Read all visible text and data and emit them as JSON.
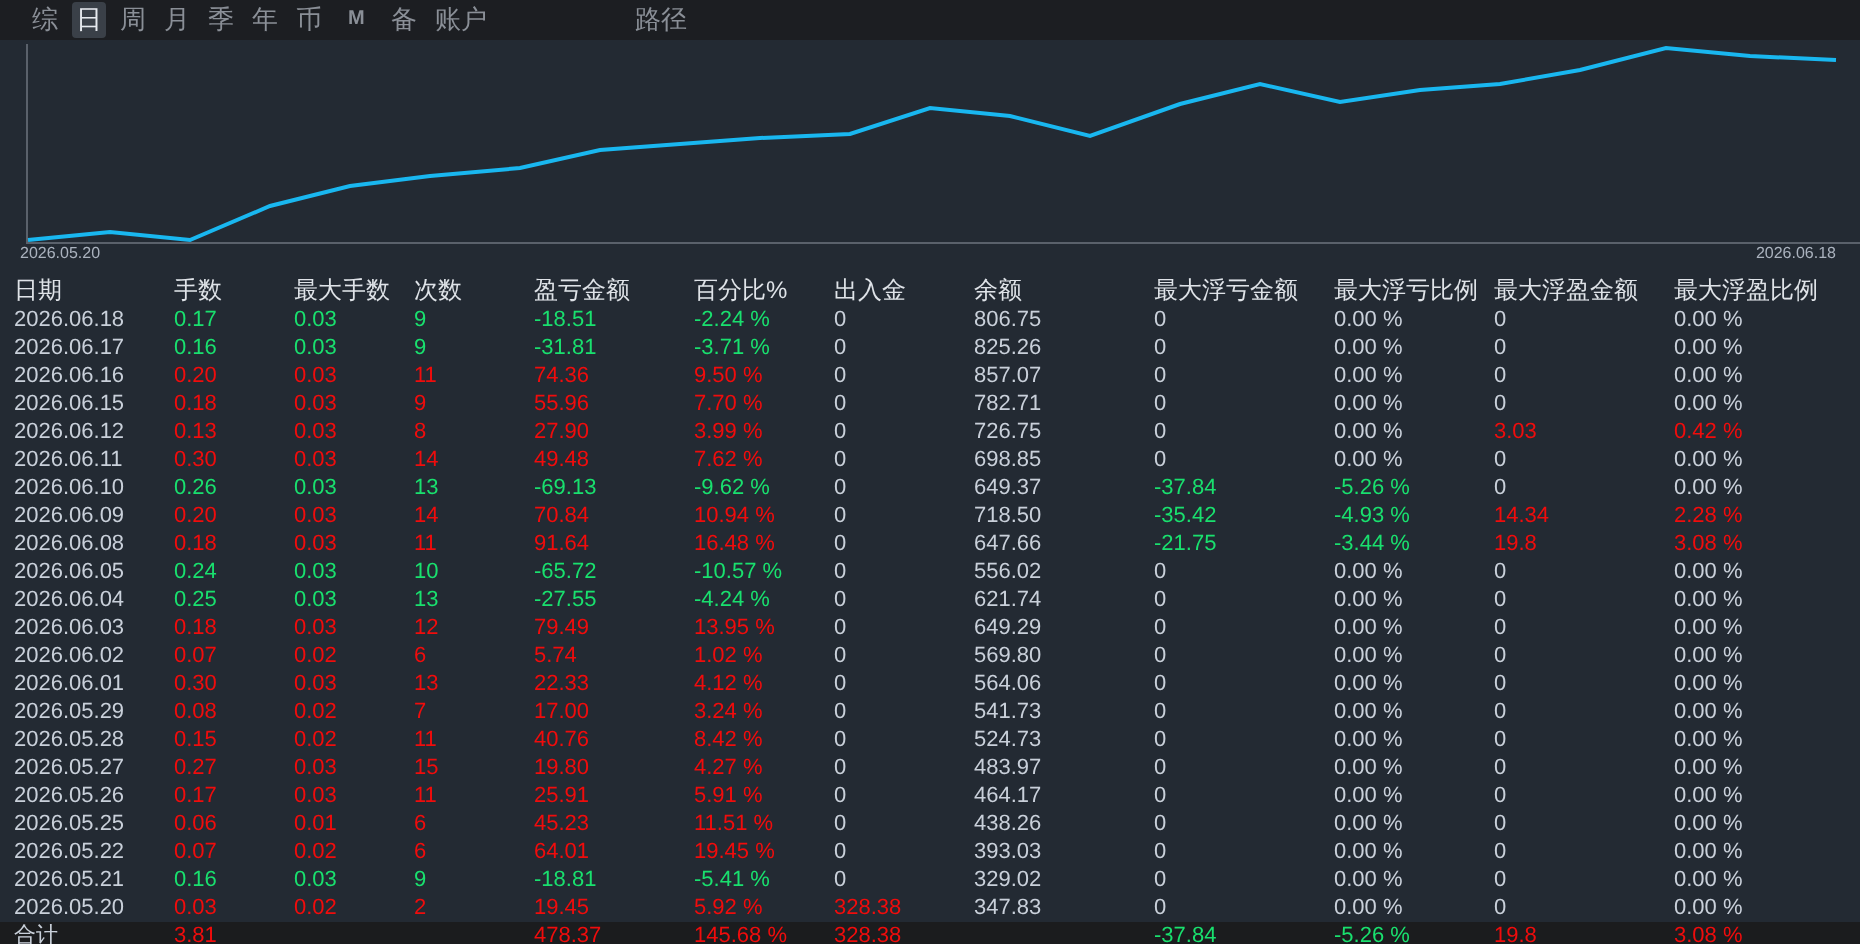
{
  "tabs": [
    {
      "label": "综",
      "selected": false
    },
    {
      "label": "日",
      "selected": true
    },
    {
      "label": "周",
      "selected": false
    },
    {
      "label": "月",
      "selected": false
    },
    {
      "label": "季",
      "selected": false
    },
    {
      "label": "年",
      "selected": false
    },
    {
      "label": "币",
      "selected": false
    },
    {
      "label": "M",
      "selected": false
    },
    {
      "label": "备",
      "selected": false
    },
    {
      "label": "账户",
      "selected": false
    },
    {
      "label": "路径",
      "selected": false
    }
  ],
  "chart": {
    "start_label": "2026.05.20",
    "end_label": "2026.06.18"
  },
  "table": {
    "columns": [
      "日期",
      "手数",
      "最大手数",
      "次数",
      "盈亏金额",
      "百分比%",
      "出入金",
      "余额",
      "最大浮亏金额",
      "最大浮亏比例",
      "最大浮盈金额",
      "最大浮盈比例"
    ],
    "rows": [
      {
        "cells": [
          "2026.06.18",
          {
            "text": "0.17",
            "color": "#19e06e"
          },
          {
            "text": "0.03",
            "color": "#19e06e"
          },
          {
            "text": "9",
            "color": "#19e06e"
          },
          {
            "text": "-18.51",
            "color": "#19e06e"
          },
          {
            "text": "-2.24 %",
            "color": "#19e06e"
          },
          "0",
          "806.75",
          "0",
          "0.00 %",
          "0",
          "0.00 %"
        ]
      },
      {
        "cells": [
          "2026.06.17",
          {
            "text": "0.16",
            "color": "#19e06e"
          },
          {
            "text": "0.03",
            "color": "#19e06e"
          },
          {
            "text": "9",
            "color": "#19e06e"
          },
          {
            "text": "-31.81",
            "color": "#19e06e"
          },
          {
            "text": "-3.71 %",
            "color": "#19e06e"
          },
          "0",
          "825.26",
          "0",
          "0.00 %",
          "0",
          "0.00 %"
        ]
      },
      {
        "cells": [
          "2026.06.16",
          {
            "text": "0.20",
            "color": "#f00c0c"
          },
          {
            "text": "0.03",
            "color": "#f00c0c"
          },
          {
            "text": "11",
            "color": "#f00c0c"
          },
          {
            "text": "74.36",
            "color": "#f00c0c"
          },
          {
            "text": "9.50 %",
            "color": "#f00c0c"
          },
          "0",
          "857.07",
          "0",
          "0.00 %",
          "0",
          "0.00 %"
        ]
      },
      {
        "cells": [
          "2026.06.15",
          {
            "text": "0.18",
            "color": "#f00c0c"
          },
          {
            "text": "0.03",
            "color": "#f00c0c"
          },
          {
            "text": "9",
            "color": "#f00c0c"
          },
          {
            "text": "55.96",
            "color": "#f00c0c"
          },
          {
            "text": "7.70 %",
            "color": "#f00c0c"
          },
          "0",
          "782.71",
          "0",
          "0.00 %",
          "0",
          "0.00 %"
        ]
      },
      {
        "cells": [
          "2026.06.12",
          {
            "text": "0.13",
            "color": "#f00c0c"
          },
          {
            "text": "0.03",
            "color": "#f00c0c"
          },
          {
            "text": "8",
            "color": "#f00c0c"
          },
          {
            "text": "27.90",
            "color": "#f00c0c"
          },
          {
            "text": "3.99 %",
            "color": "#f00c0c"
          },
          "0",
          "726.75",
          "0",
          "0.00 %",
          {
            "text": "3.03",
            "color": "#f00c0c"
          },
          {
            "text": "0.42 %",
            "color": "#f00c0c"
          }
        ]
      },
      {
        "cells": [
          "2026.06.11",
          {
            "text": "0.30",
            "color": "#f00c0c"
          },
          {
            "text": "0.03",
            "color": "#f00c0c"
          },
          {
            "text": "14",
            "color": "#f00c0c"
          },
          {
            "text": "49.48",
            "color": "#f00c0c"
          },
          {
            "text": "7.62 %",
            "color": "#f00c0c"
          },
          "0",
          "698.85",
          "0",
          "0.00 %",
          "0",
          "0.00 %"
        ]
      },
      {
        "cells": [
          "2026.06.10",
          {
            "text": "0.26",
            "color": "#19e06e"
          },
          {
            "text": "0.03",
            "color": "#19e06e"
          },
          {
            "text": "13",
            "color": "#19e06e"
          },
          {
            "text": "-69.13",
            "color": "#19e06e"
          },
          {
            "text": "-9.62 %",
            "color": "#19e06e"
          },
          "0",
          "649.37",
          {
            "text": "-37.84",
            "color": "#19e06e"
          },
          {
            "text": "-5.26 %",
            "color": "#19e06e"
          },
          "0",
          "0.00 %"
        ]
      },
      {
        "cells": [
          "2026.06.09",
          {
            "text": "0.20",
            "color": "#f00c0c"
          },
          {
            "text": "0.03",
            "color": "#f00c0c"
          },
          {
            "text": "14",
            "color": "#f00c0c"
          },
          {
            "text": "70.84",
            "color": "#f00c0c"
          },
          {
            "text": "10.94 %",
            "color": "#f00c0c"
          },
          "0",
          "718.50",
          {
            "text": "-35.42",
            "color": "#19e06e"
          },
          {
            "text": "-4.93 %",
            "color": "#19e06e"
          },
          {
            "text": "14.34",
            "color": "#f00c0c"
          },
          {
            "text": "2.28 %",
            "color": "#f00c0c"
          }
        ]
      },
      {
        "cells": [
          "2026.06.08",
          {
            "text": "0.18",
            "color": "#f00c0c"
          },
          {
            "text": "0.03",
            "color": "#f00c0c"
          },
          {
            "text": "11",
            "color": "#f00c0c"
          },
          {
            "text": "91.64",
            "color": "#f00c0c"
          },
          {
            "text": "16.48 %",
            "color": "#f00c0c"
          },
          "0",
          "647.66",
          {
            "text": "-21.75",
            "color": "#19e06e"
          },
          {
            "text": "-3.44 %",
            "color": "#19e06e"
          },
          {
            "text": "19.8",
            "color": "#f00c0c"
          },
          {
            "text": "3.08 %",
            "color": "#f00c0c"
          }
        ]
      },
      {
        "cells": [
          "2026.06.05",
          {
            "text": "0.24",
            "color": "#19e06e"
          },
          {
            "text": "0.03",
            "color": "#19e06e"
          },
          {
            "text": "10",
            "color": "#19e06e"
          },
          {
            "text": "-65.72",
            "color": "#19e06e"
          },
          {
            "text": "-10.57 %",
            "color": "#19e06e"
          },
          "0",
          "556.02",
          "0",
          "0.00 %",
          "0",
          "0.00 %"
        ]
      },
      {
        "cells": [
          "2026.06.04",
          {
            "text": "0.25",
            "color": "#19e06e"
          },
          {
            "text": "0.03",
            "color": "#19e06e"
          },
          {
            "text": "13",
            "color": "#19e06e"
          },
          {
            "text": "-27.55",
            "color": "#19e06e"
          },
          {
            "text": "-4.24 %",
            "color": "#19e06e"
          },
          "0",
          "621.74",
          "0",
          "0.00 %",
          "0",
          "0.00 %"
        ]
      },
      {
        "cells": [
          "2026.06.03",
          {
            "text": "0.18",
            "color": "#f00c0c"
          },
          {
            "text": "0.03",
            "color": "#f00c0c"
          },
          {
            "text": "12",
            "color": "#f00c0c"
          },
          {
            "text": "79.49",
            "color": "#f00c0c"
          },
          {
            "text": "13.95 %",
            "color": "#f00c0c"
          },
          "0",
          "649.29",
          "0",
          "0.00 %",
          "0",
          "0.00 %"
        ]
      },
      {
        "cells": [
          "2026.06.02",
          {
            "text": "0.07",
            "color": "#f00c0c"
          },
          {
            "text": "0.02",
            "color": "#f00c0c"
          },
          {
            "text": "6",
            "color": "#f00c0c"
          },
          {
            "text": "5.74",
            "color": "#f00c0c"
          },
          {
            "text": "1.02 %",
            "color": "#f00c0c"
          },
          "0",
          "569.80",
          "0",
          "0.00 %",
          "0",
          "0.00 %"
        ]
      },
      {
        "cells": [
          "2026.06.01",
          {
            "text": "0.30",
            "color": "#f00c0c"
          },
          {
            "text": "0.03",
            "color": "#f00c0c"
          },
          {
            "text": "13",
            "color": "#f00c0c"
          },
          {
            "text": "22.33",
            "color": "#f00c0c"
          },
          {
            "text": "4.12 %",
            "color": "#f00c0c"
          },
          "0",
          "564.06",
          "0",
          "0.00 %",
          "0",
          "0.00 %"
        ]
      },
      {
        "cells": [
          "2026.05.29",
          {
            "text": "0.08",
            "color": "#f00c0c"
          },
          {
            "text": "0.02",
            "color": "#f00c0c"
          },
          {
            "text": "7",
            "color": "#f00c0c"
          },
          {
            "text": "17.00",
            "color": "#f00c0c"
          },
          {
            "text": "3.24 %",
            "color": "#f00c0c"
          },
          "0",
          "541.73",
          "0",
          "0.00 %",
          "0",
          "0.00 %"
        ]
      },
      {
        "cells": [
          "2026.05.28",
          {
            "text": "0.15",
            "color": "#f00c0c"
          },
          {
            "text": "0.02",
            "color": "#f00c0c"
          },
          {
            "text": "11",
            "color": "#f00c0c"
          },
          {
            "text": "40.76",
            "color": "#f00c0c"
          },
          {
            "text": "8.42 %",
            "color": "#f00c0c"
          },
          "0",
          "524.73",
          "0",
          "0.00 %",
          "0",
          "0.00 %"
        ]
      },
      {
        "cells": [
          "2026.05.27",
          {
            "text": "0.27",
            "color": "#f00c0c"
          },
          {
            "text": "0.03",
            "color": "#f00c0c"
          },
          {
            "text": "15",
            "color": "#f00c0c"
          },
          {
            "text": "19.80",
            "color": "#f00c0c"
          },
          {
            "text": "4.27 %",
            "color": "#f00c0c"
          },
          "0",
          "483.97",
          "0",
          "0.00 %",
          "0",
          "0.00 %"
        ]
      },
      {
        "cells": [
          "2026.05.26",
          {
            "text": "0.17",
            "color": "#f00c0c"
          },
          {
            "text": "0.03",
            "color": "#f00c0c"
          },
          {
            "text": "11",
            "color": "#f00c0c"
          },
          {
            "text": "25.91",
            "color": "#f00c0c"
          },
          {
            "text": "5.91 %",
            "color": "#f00c0c"
          },
          "0",
          "464.17",
          "0",
          "0.00 %",
          "0",
          "0.00 %"
        ]
      },
      {
        "cells": [
          "2026.05.25",
          {
            "text": "0.06",
            "color": "#f00c0c"
          },
          {
            "text": "0.01",
            "color": "#f00c0c"
          },
          {
            "text": "6",
            "color": "#f00c0c"
          },
          {
            "text": "45.23",
            "color": "#f00c0c"
          },
          {
            "text": "11.51 %",
            "color": "#f00c0c"
          },
          "0",
          "438.26",
          "0",
          "0.00 %",
          "0",
          "0.00 %"
        ]
      },
      {
        "cells": [
          "2026.05.22",
          {
            "text": "0.07",
            "color": "#f00c0c"
          },
          {
            "text": "0.02",
            "color": "#f00c0c"
          },
          {
            "text": "6",
            "color": "#f00c0c"
          },
          {
            "text": "64.01",
            "color": "#f00c0c"
          },
          {
            "text": "19.45 %",
            "color": "#f00c0c"
          },
          "0",
          "393.03",
          "0",
          "0.00 %",
          "0",
          "0.00 %"
        ]
      },
      {
        "cells": [
          "2026.05.21",
          {
            "text": "0.16",
            "color": "#19e06e"
          },
          {
            "text": "0.03",
            "color": "#19e06e"
          },
          {
            "text": "9",
            "color": "#19e06e"
          },
          {
            "text": "-18.81",
            "color": "#19e06e"
          },
          {
            "text": "-5.41 %",
            "color": "#19e06e"
          },
          "0",
          "329.02",
          "0",
          "0.00 %",
          "0",
          "0.00 %"
        ]
      },
      {
        "cells": [
          "2026.05.20",
          {
            "text": "0.03",
            "color": "#f00c0c"
          },
          {
            "text": "0.02",
            "color": "#f00c0c"
          },
          {
            "text": "2",
            "color": "#f00c0c"
          },
          {
            "text": "19.45",
            "color": "#f00c0c"
          },
          {
            "text": "5.92 %",
            "color": "#f00c0c"
          },
          {
            "text": "328.38",
            "color": "#f00c0c"
          },
          "347.83",
          "0",
          "0.00 %",
          "0",
          "0.00 %"
        ]
      }
    ],
    "total": {
      "cells": [
        "合计",
        {
          "text": "3.81",
          "color": "#f00c0c"
        },
        null,
        null,
        {
          "text": "478.37",
          "color": "#f00c0c"
        },
        {
          "text": "145.68 %",
          "color": "#f00c0c"
        },
        {
          "text": "328.38",
          "color": "#f00c0c"
        },
        null,
        {
          "text": "-37.84",
          "color": "#19e06e"
        },
        {
          "text": "-5.26 %",
          "color": "#19e06e"
        },
        {
          "text": "19.8",
          "color": "#f00c0c"
        },
        {
          "text": "3.08 %",
          "color": "#f00c0c"
        }
      ]
    }
  }
}
